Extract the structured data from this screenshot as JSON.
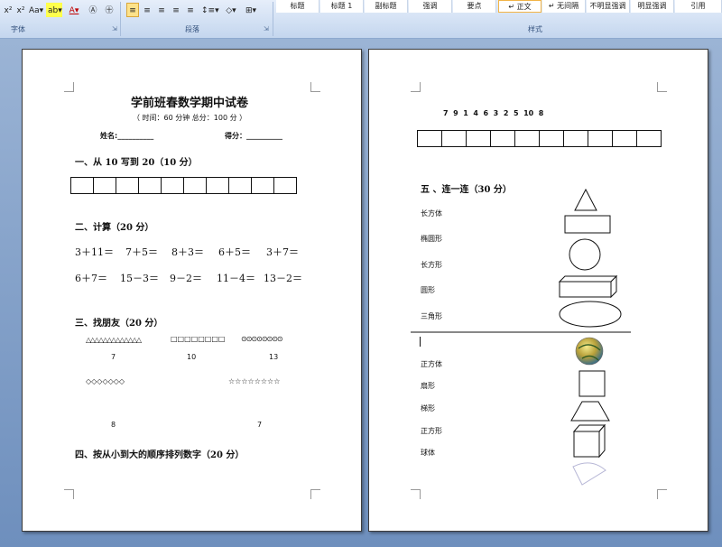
{
  "ribbon": {
    "font_buttons": [
      "x²",
      "x²",
      "Aa▾",
      "ab▾",
      "A",
      "A▾",
      "Ⓐ",
      "㊉"
    ],
    "para_buttons": [
      "≡",
      "≡",
      "≡",
      "≡",
      "≡",
      "↕≡▾",
      "◇▾",
      "⊞▾"
    ],
    "groups": {
      "font": "字体",
      "paragraph": "段落",
      "styles": "样式"
    },
    "styles": [
      "标题",
      "标题 1",
      "副标题",
      "强调",
      "要点",
      "↵ 正文",
      "↵ 无间隔",
      "不明显强调",
      "明显强调",
      "引用"
    ]
  },
  "page1": {
    "title": "学前班春数学期中试卷",
    "subtitle": "（ 时间：60 分钟    总分：100 分 ）",
    "name_label": "姓名:__________",
    "score_label": "得分：__________",
    "s1": "一、从 10 写到 20（10 分）",
    "s2": "二、计算（20 分）",
    "calc_row1": [
      "3＋11＝",
      "7＋5＝",
      "8＋3＝",
      "6＋5＝",
      "3＋7＝"
    ],
    "calc_row2": [
      "6＋7＝",
      "15－3＝",
      "9－2＝",
      "11－4＝",
      "13－2＝"
    ],
    "s3": "三、找朋友（20 分）",
    "group_triangles": "△△△△△△△△△△△△△",
    "group_squares": "□□□□□□□□",
    "group_circles": "⊙⊙⊙⊙⊙⊙⊙⊙",
    "num_7": "7",
    "num_10": "10",
    "num_13": "13",
    "group_diamonds": "◇◇◇◇◇◇◇",
    "group_stars": "☆☆☆☆☆☆☆☆",
    "num_8": "8",
    "num_7b": "7",
    "s4": "四、按从小到大的顺序排列数字（20 分）"
  },
  "page2": {
    "sequence": "7  9  1  4  6  3  2  5  10  8",
    "s5": "五 、连一连（30 分）",
    "labels_a": [
      "长方体",
      "椭圆形",
      "长方形",
      "圆形",
      "三角形"
    ],
    "labels_b": [
      "正方体",
      "扇形",
      "梯形",
      "正方形",
      "球体"
    ]
  }
}
